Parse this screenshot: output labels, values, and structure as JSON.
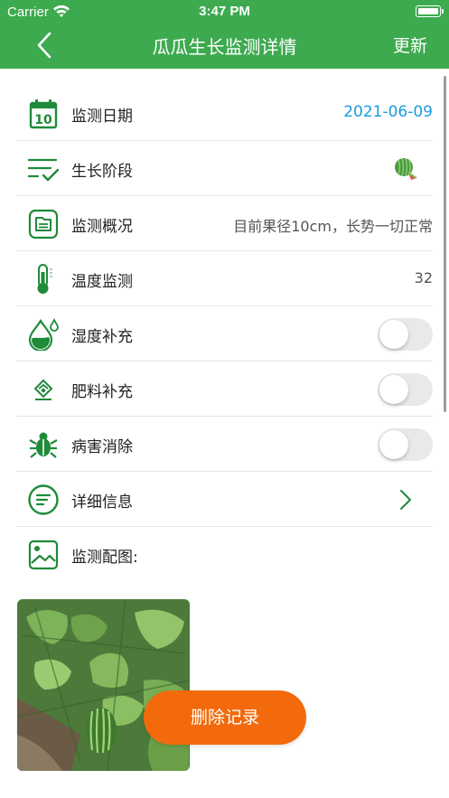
{
  "status_bar": {
    "carrier": "Carrier",
    "time": "3:47 PM"
  },
  "nav": {
    "title": "瓜瓜生长监测详情",
    "update_label": "更新"
  },
  "rows": [
    {
      "label": "监测日期",
      "value": "2021-06-09",
      "icon": "calendar-icon",
      "calendar_day": "10"
    },
    {
      "label": "生长阶段",
      "icon": "growth-stage-icon",
      "value_icon": "watermelon-icon"
    },
    {
      "label": "监测概况",
      "value": "目前果径10cm，长势一切正常",
      "icon": "document-icon"
    },
    {
      "label": "温度监测",
      "value": "32",
      "icon": "thermometer-icon"
    },
    {
      "label": "湿度补充",
      "icon": "humidity-icon",
      "toggle_on": false
    },
    {
      "label": "肥料补充",
      "icon": "fertilizer-icon",
      "toggle_on": false
    },
    {
      "label": "病害消除",
      "icon": "bug-icon",
      "toggle_on": false
    },
    {
      "label": "详细信息",
      "icon": "details-icon"
    },
    {
      "label": "监测配图:",
      "icon": "image-icon"
    }
  ],
  "delete_label": "删除记录",
  "colors": {
    "primary": "#3daa4f",
    "accent_blue": "#1a9be0",
    "delete": "#f26a0c",
    "toggle_off": "#e9e9eb"
  }
}
